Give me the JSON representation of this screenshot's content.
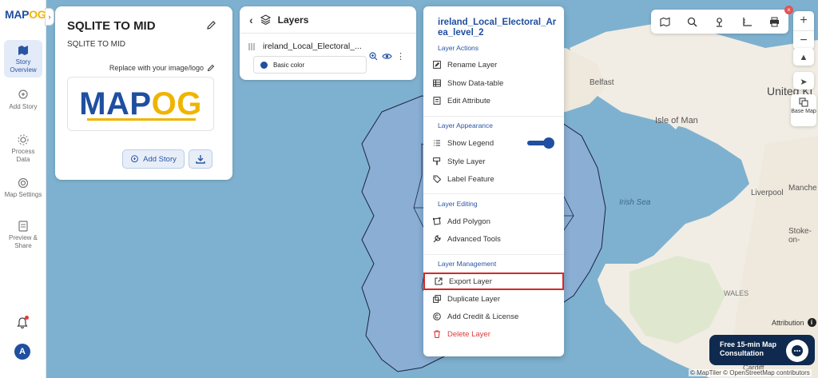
{
  "rail": {
    "logo_part1": "MAP",
    "logo_part2": "OG",
    "items": [
      {
        "label": "Story Overview"
      },
      {
        "label": "Add Story"
      },
      {
        "label": "Process Data"
      },
      {
        "label": "Map Settings"
      },
      {
        "label": "Preview & Share"
      }
    ],
    "avatar": "A"
  },
  "story": {
    "title": "SQLITE TO MID",
    "description": "SQLITE TO MID",
    "replace_label": "Replace with your image/logo",
    "logo_part1": "MAP",
    "logo_part2": "OG",
    "add_story_label": "Add Story"
  },
  "layers": {
    "title": "Layers",
    "layer_name": "ireland_Local_Electoral_...",
    "style_label": "Basic color",
    "style_color": "#1f4fa0"
  },
  "menu": {
    "title": "ireland_Local_Electoral_Area_level_2",
    "sections": {
      "actions": "Layer Actions",
      "appearance": "Layer Appearance",
      "editing": "Layer Editing",
      "management": "Layer Management"
    },
    "items": {
      "rename": "Rename Layer",
      "datatable": "Show Data-table",
      "edit_attr": "Edit Attribute",
      "legend": "Show Legend",
      "style": "Style Layer",
      "label": "Label Feature",
      "add_polygon": "Add Polygon",
      "advanced": "Advanced Tools",
      "export": "Export Layer",
      "duplicate": "Duplicate Layer",
      "credit": "Add Credit & License",
      "delete": "Delete Layer"
    },
    "legend_enabled": true,
    "highlight_color": "#d62828"
  },
  "map": {
    "labels": {
      "belfast": "Belfast",
      "isle_of_man": "Isle of Man",
      "united_kingdom": "United Ki",
      "irish_sea": "Irish Sea",
      "liverpool": "Liverpool",
      "manchester": "Manche",
      "stoke": "Stoke-on-",
      "wales": "WALES",
      "cardiff": "Cardiff"
    },
    "basemap_label": "Base Map",
    "attribution": "Attribution",
    "footer": "© MapTiler © OpenStreetMap contributors"
  },
  "consult": {
    "line1": "Free 15-min Map",
    "line2": "Consultation"
  }
}
